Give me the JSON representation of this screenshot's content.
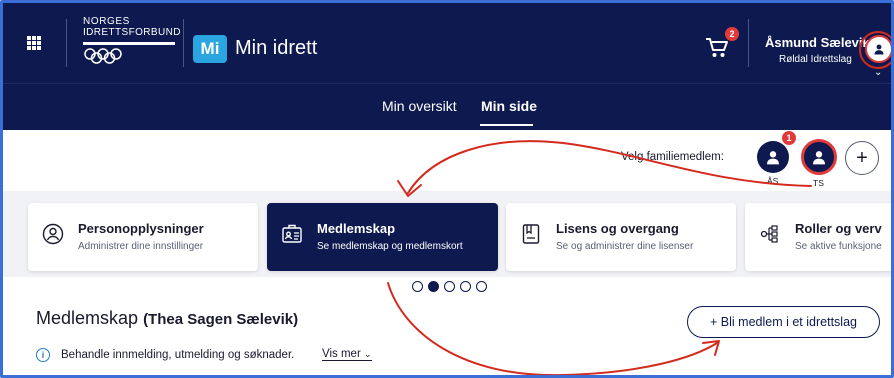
{
  "header": {
    "org_line1": "NORGES",
    "org_line2": "IDRETTSFORBUND",
    "app_badge": "Mi",
    "app_name": "Min idrett",
    "cart_count": "2",
    "user_name": "Åsmund Sælevik",
    "user_club": "Røldal Idrettslag"
  },
  "subnav": {
    "tabs": [
      {
        "label": "Min oversikt",
        "active": false
      },
      {
        "label": "Min side",
        "active": true
      }
    ]
  },
  "family": {
    "label": "Velg familiemedlem:",
    "members": [
      {
        "initials": "ÅS",
        "badge": "1",
        "selected": false
      },
      {
        "initials": "TS",
        "badge": "",
        "selected": true
      }
    ],
    "add_label": "+"
  },
  "cards": [
    {
      "title": "Personopplysninger",
      "subtitle": "Administrer dine innstillinger",
      "icon": "person-circle-icon",
      "active": false
    },
    {
      "title": "Medlemskap",
      "subtitle": "Se medlemskap og medlemskort",
      "icon": "membership-card-icon",
      "active": true
    },
    {
      "title": "Lisens og overgang",
      "subtitle": "Se og administrer dine lisenser",
      "icon": "license-document-icon",
      "active": false
    },
    {
      "title": "Roller og verv",
      "subtitle": "Se aktive funksjone",
      "icon": "roles-hierarchy-icon",
      "active": false
    }
  ],
  "carousel": {
    "count": 5,
    "active_index": 1
  },
  "section": {
    "title": "Medlemskap",
    "person": "(Thea Sagen Sælevik)",
    "join_button": "+ Bli medlem i et idrettslag",
    "info_text": "Behandle innmelding, utmelding og søknader.",
    "more_link": "Vis mer"
  },
  "colors": {
    "navy": "#0e1a4f",
    "accent_blue": "#2aa5e0",
    "badge_red": "#e03b3b",
    "annotation_red": "#d42a1e"
  }
}
